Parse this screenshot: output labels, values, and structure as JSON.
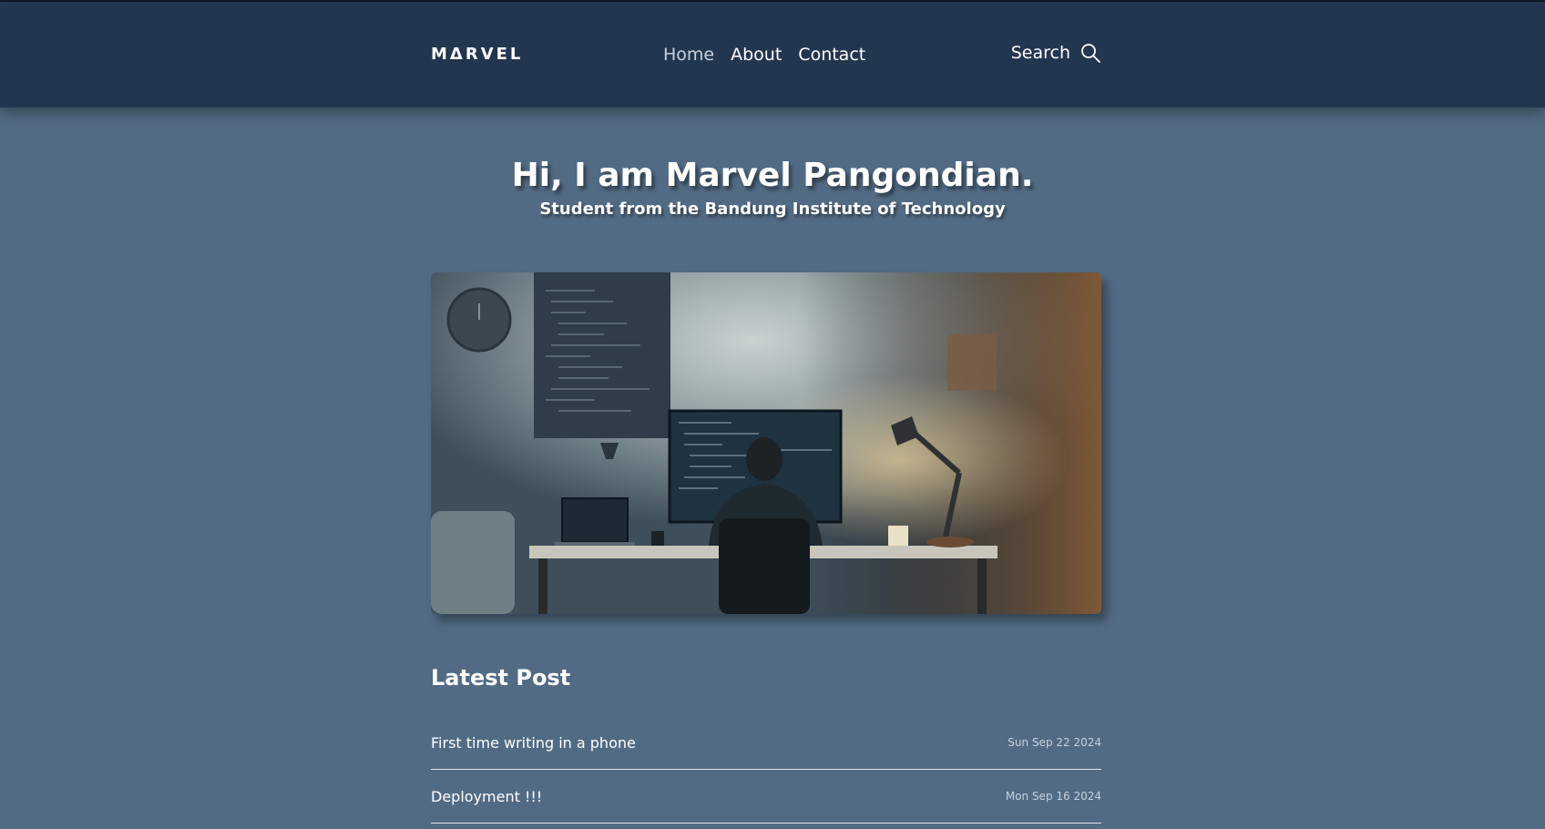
{
  "brand": {
    "logo": "MΔRVEL"
  },
  "nav": {
    "links": [
      {
        "label": "Home"
      },
      {
        "label": "About"
      },
      {
        "label": "Contact"
      }
    ],
    "search_label": "Search"
  },
  "hero": {
    "title": "Hi, I am Marvel Pangondian.",
    "subtitle": "Student from the Bandung Institute of Technology"
  },
  "latest": {
    "heading": "Latest Post",
    "posts": [
      {
        "title": "First time writing in a phone",
        "date": "Sun Sep 22 2024"
      },
      {
        "title": "Deployment !!!",
        "date": "Mon Sep 16 2024"
      }
    ]
  },
  "colors": {
    "background": "#526b84",
    "navbar": "#233650",
    "text": "#ffffff"
  },
  "icons": {
    "search": "search-icon"
  }
}
